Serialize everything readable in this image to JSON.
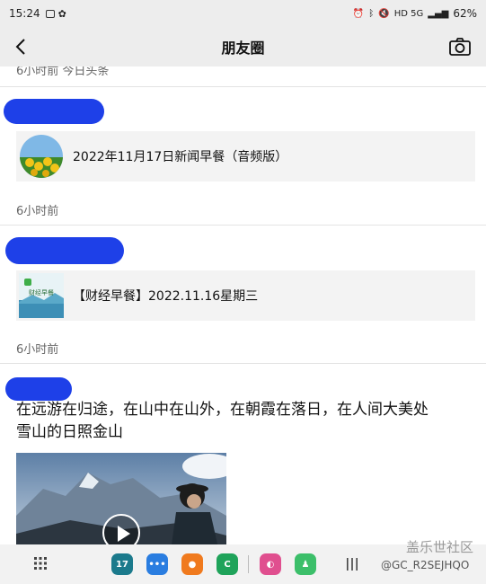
{
  "status_bar": {
    "time": "15:24",
    "network": "HD 5G",
    "battery": "62%"
  },
  "header": {
    "title": "朋友圈"
  },
  "feed": {
    "partial_top_text": "6小时前  今日头条",
    "posts": [
      {
        "link_title": "2022年11月17日新闻早餐（音频版）",
        "time": "6小时前"
      },
      {
        "link_title": "【财经早餐】2022.11.16星期三",
        "thumb_label": "财经早餐",
        "time": "6小时前"
      },
      {
        "text_line1": "在远游在归途，在山中在山外，在朝霞在落日，在人间大美处",
        "text_line2": "雪山的日照金山"
      }
    ]
  },
  "nav_bar": {
    "dock_calendar_label": "17",
    "watermark_top": "盖乐世社区",
    "watermark_bottom": "@GC_R2SEJHQO"
  },
  "colors": {
    "header_bg": "#ededed",
    "redaction_blue": "#1e40e8",
    "link_card_bg": "#f3f3f3"
  }
}
